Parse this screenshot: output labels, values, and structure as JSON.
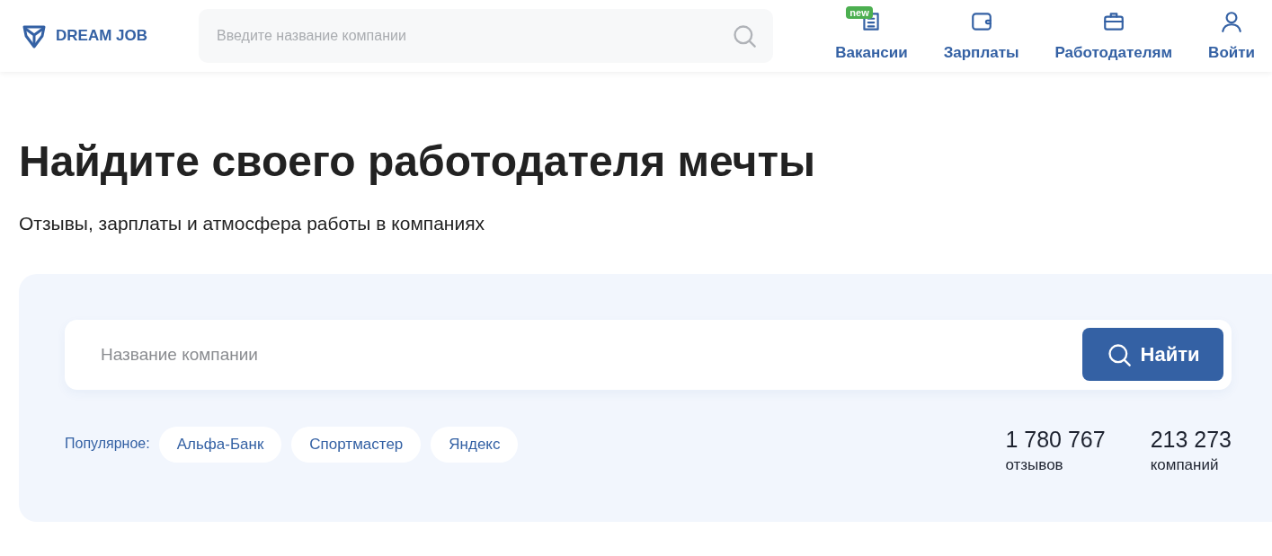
{
  "header": {
    "logo": "DREAM JOB",
    "search": {
      "placeholder": "Введите название компании"
    },
    "nav": [
      {
        "kind": "news",
        "label": "Вакансии",
        "badge": "new"
      },
      {
        "kind": "wallet",
        "label": "Зарплаты"
      },
      {
        "kind": "briefcase",
        "label": "Работодателям"
      },
      {
        "kind": "user",
        "label": "Войти"
      }
    ]
  },
  "hero": {
    "title": "Найдите своего работодателя мечты",
    "subtitle": "Отзывы, зарплаты и атмосфера работы в компаниях"
  },
  "search_panel": {
    "field": {
      "placeholder": "Название компании"
    },
    "button": "Найти",
    "popular_label": "Популярное:",
    "popular": [
      "Альфа-Банк",
      "Спортмастер",
      "Яндекс"
    ],
    "stats": [
      {
        "value": "1 780 767",
        "label": "отзывов"
      },
      {
        "value": "213 273",
        "label": "компаний"
      }
    ]
  }
}
